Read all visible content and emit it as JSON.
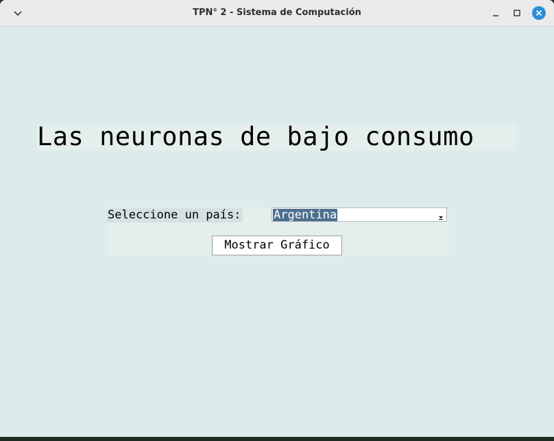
{
  "window": {
    "title": "TPN° 2 - Sistema de Computación"
  },
  "main": {
    "heading": "Las neuronas de bajo consumo",
    "country_label": "Seleccione un país:",
    "country_selected": "Argentina",
    "show_chart_label": "Mostrar Gráfico"
  },
  "icons": {
    "menu": "chevron-down-icon",
    "minimize": "minimize-icon",
    "maximize": "maximize-icon",
    "close": "close-icon",
    "dropdown": "dropdown-arrow-icon"
  },
  "colors": {
    "window_background": "#dbeceb",
    "selection": "#4c6e8f",
    "close_button": "#2a8fd8"
  }
}
